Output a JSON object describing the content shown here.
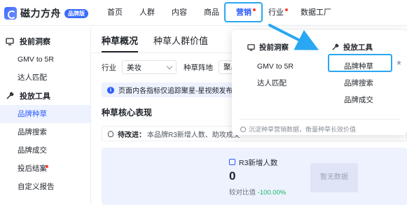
{
  "brand": {
    "name": "磁力方舟",
    "badge": "品牌版"
  },
  "nav": {
    "items": [
      "首页",
      "人群",
      "内容",
      "商品",
      "营销",
      "行业",
      "数据工厂"
    ],
    "active": "营销"
  },
  "sidebar": {
    "group1": "投前洞察",
    "group1_items": [
      "GMV to 5R",
      "达人匹配"
    ],
    "group2": "投放工具",
    "group2_items": [
      "品牌种草",
      "品牌搜索",
      "品牌成交",
      "投后结案",
      "自定义报告"
    ],
    "active_item": "品牌种草"
  },
  "main": {
    "tabs": [
      "种草概况",
      "种草人群价值"
    ],
    "filter_industry_label": "行业",
    "filter_industry_value": "美妆",
    "filter_position_label": "种草阵地",
    "filter_position_value": "聚星",
    "notice": "页面内各指标仅追踪聚星-星视频发布后",
    "section_title": "种草核心表现",
    "improve_label": "待改进：",
    "improve_text": "本品牌R3新增人数、助攻成交",
    "metric_title": "R3新增人数",
    "metric_value": "0",
    "metric_compare_label": "较对比值",
    "metric_compare_value": "-100.00%",
    "empty_text": "暂无数据"
  },
  "dropdown": {
    "col1_title": "投前洞察",
    "col1_items": [
      "GMV to 5R",
      "达人匹配"
    ],
    "col2_title": "投放工具",
    "col2_items": [
      "品牌种草",
      "品牌搜索",
      "品牌成交"
    ],
    "footer": "沉淀种草营销数据，衡量种草长效价值"
  },
  "colors": {
    "accent": "#2b5cff",
    "highlight": "#2aa7f2",
    "dot": "#ff3b30",
    "positive": "#14b866"
  }
}
